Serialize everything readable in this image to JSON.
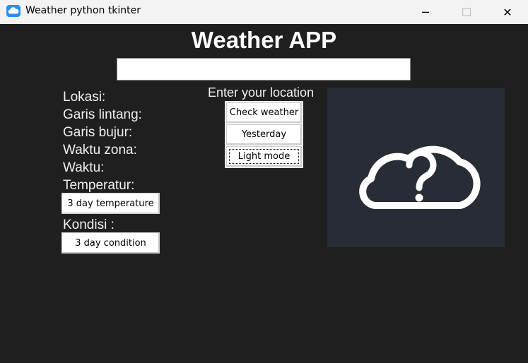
{
  "window": {
    "title": "Weather python tkinter",
    "minimize_glyph": "─",
    "maximize_glyph": "☐",
    "close_glyph": "✕"
  },
  "app": {
    "heading": "Weather APP",
    "search": {
      "value": "",
      "placeholder": ""
    },
    "prompt": "Enter your location",
    "buttons": {
      "check_weather": "Check weather",
      "yesterday": "Yesterday",
      "light_mode": "Light mode"
    },
    "info_labels": {
      "location": "Lokasi:",
      "latitude": "Garis lintang:",
      "longitude": "Garis bujur:",
      "timezone": "Waktu zona:",
      "time": "Waktu:",
      "temperature": "Temperatur:",
      "condition": "Kondisi :"
    },
    "forecast_buttons": {
      "temperature": "3 day temperature",
      "condition": "3 day condition"
    },
    "weather_icon": "cloud-question-icon"
  },
  "colors": {
    "background": "#1f1f1f",
    "titlebar": "#f3f3f3",
    "text": "#f0f0f0",
    "icon_panel": "#282c35"
  }
}
